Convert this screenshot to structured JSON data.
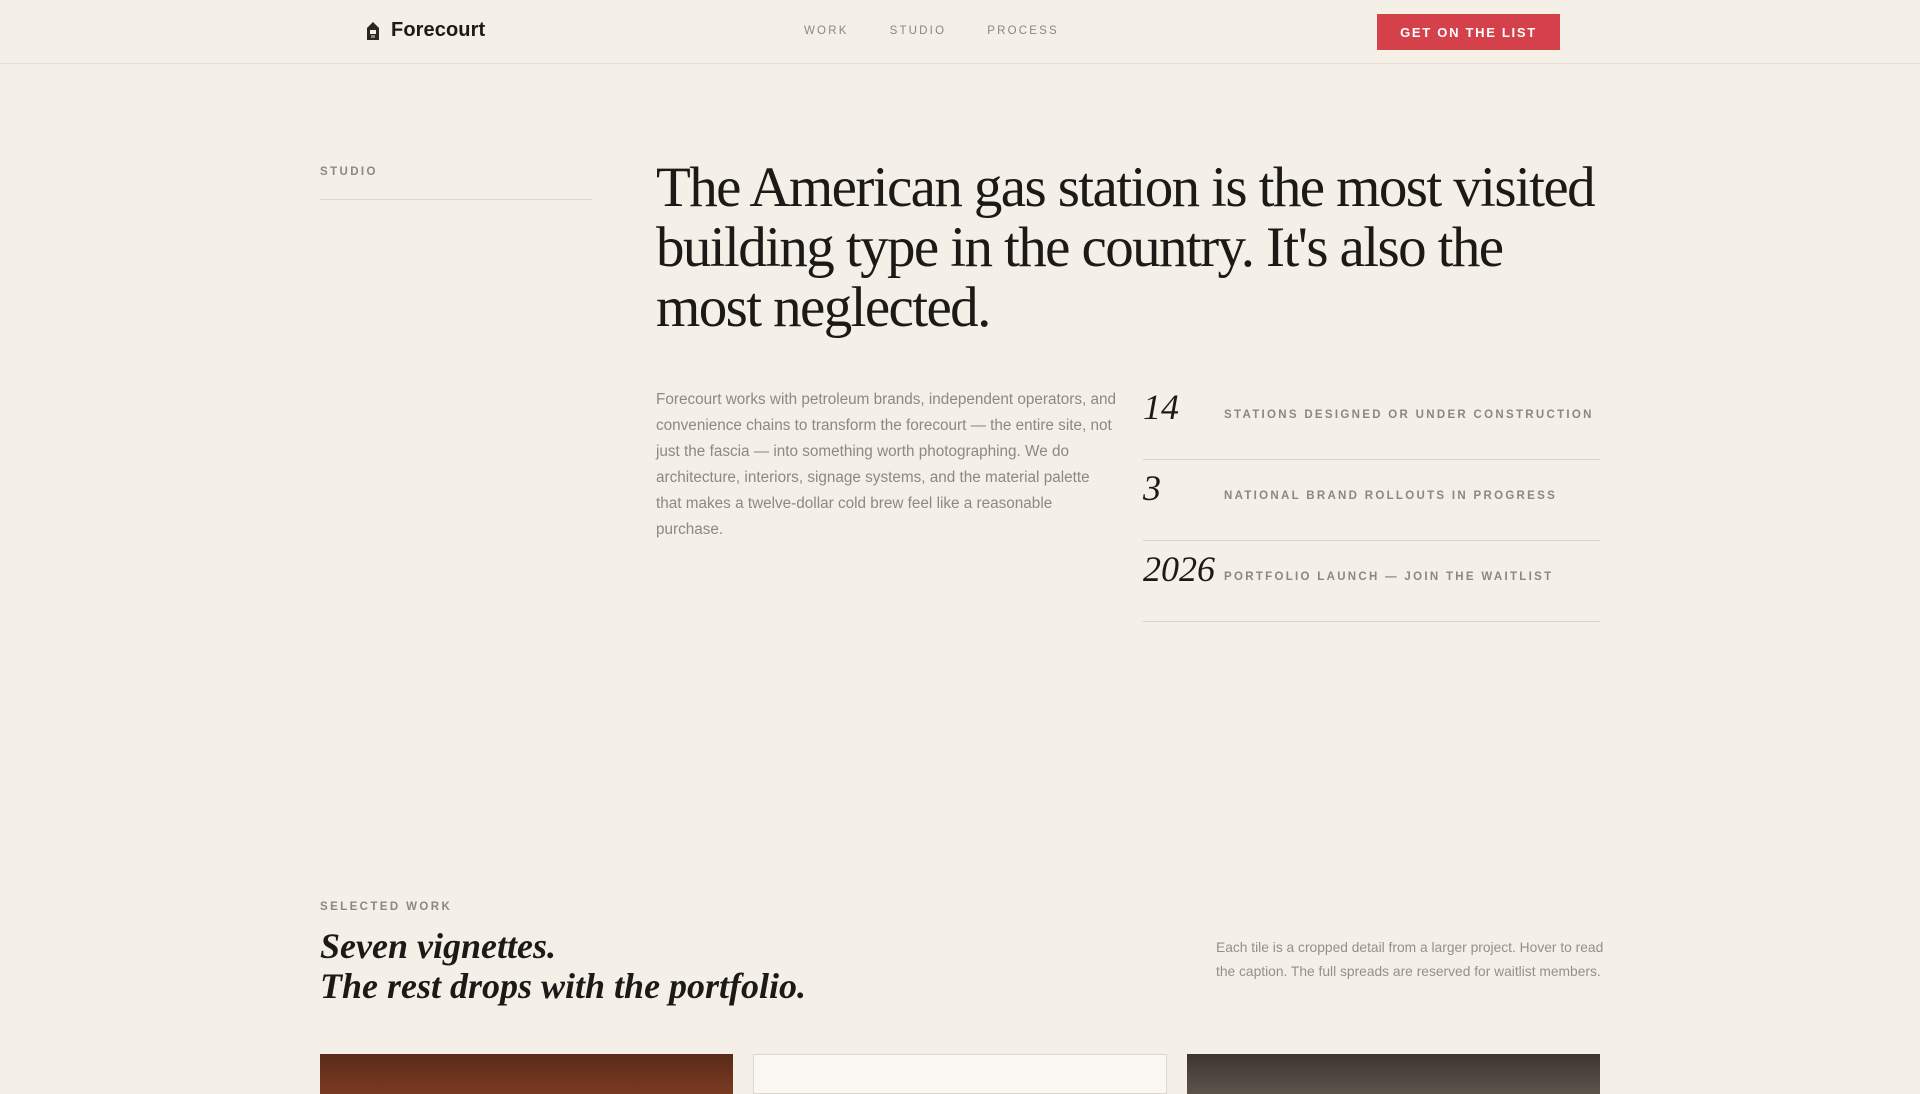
{
  "header": {
    "brand": "Forecourt",
    "nav": [
      "WORK",
      "STUDIO",
      "PROCESS"
    ],
    "cta": "GET ON THE LIST"
  },
  "studio": {
    "label": "STUDIO",
    "headline": "The American gas station is the most visited building type in the country. It's also the most neglected.",
    "body": "Forecourt works with petroleum brands, independent operators, and convenience chains to transform the forecourt — the entire site, not just the fascia — into something worth photographing. We do architecture, interiors, signage systems, and the material palette that makes a twelve-dollar cold brew feel like a reasonable purchase.",
    "stats": [
      {
        "number": "14",
        "label": "STATIONS DESIGNED OR UNDER CONSTRUCTION"
      },
      {
        "number": "3",
        "label": "NATIONAL BRAND ROLLOUTS IN PROGRESS"
      },
      {
        "number": "2026",
        "label": "PORTFOLIO LAUNCH — JOIN THE WAITLIST"
      }
    ]
  },
  "selected_work": {
    "label": "SELECTED WORK",
    "title_line1": "Seven vignettes.",
    "title_line2": "The rest drops with the portfolio.",
    "note": "Each tile is a cropped detail from a larger project. Hover to read the caption. The full spreads are reserved for waitlist members."
  },
  "colors": {
    "background": "#f4efe7",
    "accent": "#d5414a",
    "text": "#1c1a17",
    "muted": "#8c877f"
  }
}
